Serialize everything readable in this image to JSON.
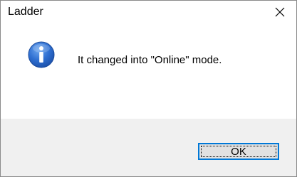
{
  "window": {
    "title": "Ladder",
    "close_icon": "close-icon"
  },
  "message": {
    "icon": "info-icon",
    "text": "It changed into \"Online\" mode."
  },
  "buttons": {
    "ok_label": "OK"
  },
  "colors": {
    "accent": "#0078d7",
    "footer_bg": "#f0f0f0",
    "button_bg": "#e1e1e1"
  }
}
